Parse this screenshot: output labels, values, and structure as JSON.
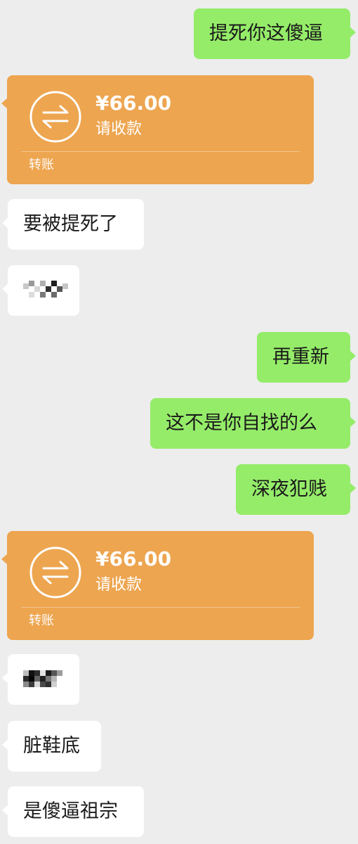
{
  "messages": [
    {
      "from": "me",
      "type": "text",
      "text": "提死你这傻逼"
    },
    {
      "from": "other",
      "type": "transfer",
      "amount": "¥66.00",
      "status": "请收款",
      "kind": "转账"
    },
    {
      "from": "other",
      "type": "text",
      "text": "要被提死了"
    },
    {
      "from": "other",
      "type": "pixelated",
      "text": ""
    },
    {
      "from": "me",
      "type": "text",
      "text": "再重新"
    },
    {
      "from": "me",
      "type": "text",
      "text": "这不是你自找的么"
    },
    {
      "from": "me",
      "type": "text",
      "text": "深夜犯贱"
    },
    {
      "from": "other",
      "type": "transfer",
      "amount": "¥66.00",
      "status": "请收款",
      "kind": "转账"
    },
    {
      "from": "other",
      "type": "pixelated",
      "text": ""
    },
    {
      "from": "other",
      "type": "text",
      "text": "脏鞋底"
    },
    {
      "from": "other",
      "type": "text",
      "text": "是傻逼祖宗"
    }
  ],
  "colors": {
    "background": "#ededed",
    "sent_bubble": "#95ec69",
    "received_bubble": "#ffffff",
    "transfer_card": "#eda550"
  },
  "icons": {
    "transfer": "transfer-arrows-icon"
  }
}
